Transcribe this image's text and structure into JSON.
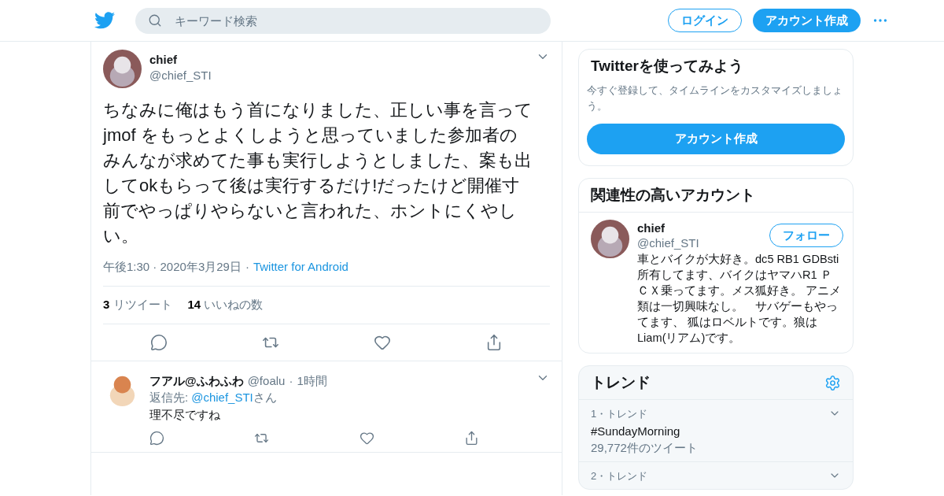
{
  "header": {
    "search_placeholder": "キーワード検索",
    "login": "ログイン",
    "signup": "アカウント作成"
  },
  "tweet": {
    "name": "chief",
    "handle": "@chief_STI",
    "text": "ちなみに俺はもう首になりました、正しい事を言ってjmof をもっとよくしようと思っていました参加者のみんなが求めてた事も実行しようとしました、案も出してokもらって後は実行するだけ!だったけど開催寸前でやっぱりやらないと言われた、ホントにくやしい。",
    "time": "午後1:30 · 2020年3月29日",
    "separator": "·",
    "source": "Twitter for Android",
    "stats": [
      {
        "count": "3",
        "label": "リツイート"
      },
      {
        "count": "14",
        "label": "いいねの数"
      }
    ]
  },
  "replies": [
    {
      "name": "フアル@ふわふわ",
      "handle": "@foalu",
      "separator": "·",
      "age": "1時間",
      "reply_to_label": "返信先:",
      "reply_to": "@chief_STI",
      "reply_to_suffix": "さん",
      "text": "理不尽ですね"
    }
  ],
  "signup_card": {
    "title": "Twitterを使ってみよう",
    "text": "今すぐ登録して、タイムラインをカスタマイズしましょう。",
    "button": "アカウント作成"
  },
  "related": {
    "title": "関連性の高いアカウント",
    "accounts": [
      {
        "name": "chief",
        "handle": "@chief_STI",
        "follow": "フォロー",
        "bio": "車とバイクが大好き。dc5 RB1 GDBsti所有してます、バイクはヤマハR1 ＰＣＸ乗ってます。メス狐好き。 アニメ類は一切興味なし。　サバゲーもやってます、 狐はロベルトです。狼はLiam(リアム)です。"
      }
    ]
  },
  "trends": {
    "title": "トレンド",
    "items": [
      {
        "rank": "1・トレンド",
        "name": "#SundayMorning",
        "count": "29,772件のツイート"
      },
      {
        "rank": "2・トレンド"
      }
    ]
  }
}
